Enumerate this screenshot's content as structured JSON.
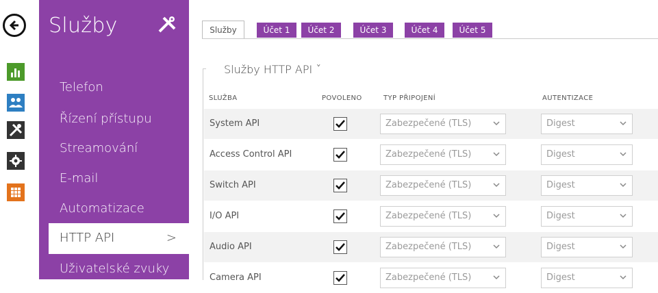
{
  "sidebar": {
    "title": "Služby",
    "items": [
      {
        "label": "Telefon"
      },
      {
        "label": "Řízení přístupu"
      },
      {
        "label": "Streamování"
      },
      {
        "label": "E-mail"
      },
      {
        "label": "Automatizace"
      },
      {
        "label": "HTTP API"
      },
      {
        "label": "Uživatelské zvuky"
      }
    ],
    "active_chevron": ">"
  },
  "tabs": [
    "Služby",
    "Účet 1",
    "Účet 2",
    "Účet 3",
    "Účet 4",
    "Účet 5"
  ],
  "section": {
    "title": "Služby HTTP API ˇ"
  },
  "table": {
    "headers": [
      "SLUŽBA",
      "POVOLENO",
      "TYP PŘIPOJENÍ",
      "AUTENTIZACE"
    ],
    "rows": [
      {
        "name": "System API",
        "enabled": true,
        "connection": "Zabezpečené (TLS)",
        "auth": "Digest"
      },
      {
        "name": "Access Control API",
        "enabled": true,
        "connection": "Zabezpečené (TLS)",
        "auth": "Digest"
      },
      {
        "name": "Switch API",
        "enabled": true,
        "connection": "Zabezpečené (TLS)",
        "auth": "Digest"
      },
      {
        "name": "I/O API",
        "enabled": true,
        "connection": "Zabezpečené (TLS)",
        "auth": "Digest"
      },
      {
        "name": "Audio API",
        "enabled": true,
        "connection": "Zabezpečené (TLS)",
        "auth": "Digest"
      },
      {
        "name": "Camera API",
        "enabled": true,
        "connection": "Zabezpečené (TLS)",
        "auth": "Digest"
      }
    ]
  },
  "colors": {
    "accent": "#8c41a6",
    "green": "#4c9a2a",
    "blue": "#2e7fc2",
    "orange": "#e3731c",
    "dark": "#333333"
  },
  "icons": {
    "back": "arrow-left-icon",
    "rail": [
      "bar-chart-icon",
      "users-icon",
      "tools-icon",
      "gear-icon",
      "grid-icon"
    ],
    "header": "tools-icon"
  }
}
